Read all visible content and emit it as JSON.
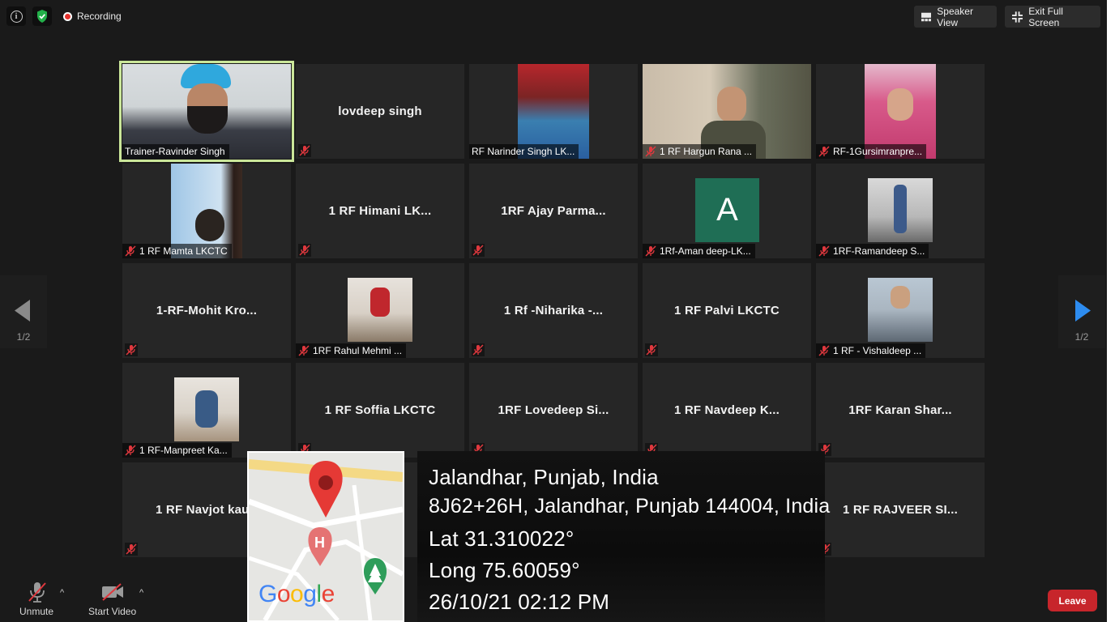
{
  "topbar": {
    "recording_label": "Recording",
    "speaker_view_label": "Speaker View",
    "exit_fullscreen_label": "Exit Full Screen"
  },
  "participants": [
    {
      "name": "Trainer-Ravinder Singh",
      "has_video": true,
      "active_speaker": true,
      "muted": false
    },
    {
      "name": "lovdeep singh",
      "has_video": false,
      "muted": true
    },
    {
      "name": "RF Narinder Singh LK...",
      "has_video": true,
      "muted": false
    },
    {
      "name": "1 RF Hargun Rana ...",
      "has_video": true,
      "muted": true
    },
    {
      "name": "RF-1Gursimranpre...",
      "has_video": true,
      "muted": true
    },
    {
      "name": "1 RF Mamta LKCTC",
      "has_video": true,
      "muted": true
    },
    {
      "name": "1 RF Himani LK...",
      "has_video": false,
      "muted": true
    },
    {
      "name": "1RF Ajay Parma...",
      "has_video": false,
      "muted": true
    },
    {
      "name": "1Rf-Aman deep-LK...",
      "has_video": true,
      "avatar_letter": "A",
      "muted": true
    },
    {
      "name": "1RF-Ramandeep S...",
      "has_video": true,
      "muted": true
    },
    {
      "name": "1-RF-Mohit Kro...",
      "has_video": false,
      "muted": true
    },
    {
      "name": "1RF Rahul Mehmi ...",
      "has_video": true,
      "muted": true
    },
    {
      "name": "1 Rf -Niharika -...",
      "has_video": false,
      "muted": true
    },
    {
      "name": "1 RF Palvi LKCTC",
      "has_video": false,
      "muted": true
    },
    {
      "name": "1 RF - Vishaldeep ...",
      "has_video": true,
      "muted": true
    },
    {
      "name": "1 RF-Manpreet Ka...",
      "has_video": true,
      "muted": true
    },
    {
      "name": "1 RF Soffia LKCTC",
      "has_video": false,
      "muted": true
    },
    {
      "name": "1RF Lovedeep Si...",
      "has_video": false,
      "muted": true
    },
    {
      "name": "1 RF Navdeep K...",
      "has_video": false,
      "muted": true
    },
    {
      "name": "1RF Karan Shar...",
      "has_video": false,
      "muted": true
    },
    {
      "name": "1 RF Navjot kau",
      "has_video": false,
      "muted": true
    },
    {
      "name": "1 RF RAJVEER SI...",
      "has_video": false,
      "muted": true
    }
  ],
  "pager": {
    "left": "1/2",
    "right": "1/2"
  },
  "location_overlay": {
    "map_brand": "Google",
    "city": "Jalandhar, Punjab, India",
    "address": "8J62+26H, Jalandhar, Punjab 144004, India",
    "lat": "Lat 31.310022°",
    "long": "Long 75.60059°",
    "datetime": "26/10/21 02:12 PM"
  },
  "bottombar": {
    "unmute_label": "Unmute",
    "start_video_label": "Start Video",
    "leave_label": "Leave"
  },
  "colors": {
    "active_speaker_border": "#cbe79a",
    "leave": "#c7252b",
    "arrow": "#2d8cf0",
    "muted_icon": "#e0383e"
  }
}
